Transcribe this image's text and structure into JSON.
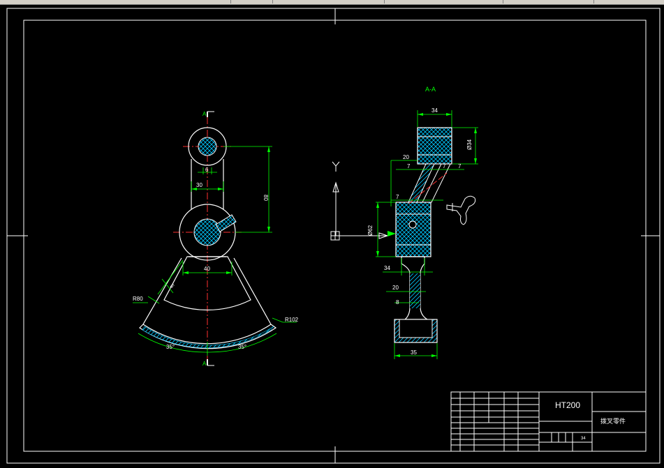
{
  "drawing": {
    "section_title": "A-A",
    "section_marks": [
      "A",
      "A"
    ],
    "material": "HT200",
    "part_name": "拨叉零件",
    "sheet_number": "34",
    "ucs_y_label": "Y",
    "colors": {
      "background": "#000000",
      "outline": "#ffffff",
      "dimension": "#00ff00",
      "centerline": "#ff0000",
      "hatch": "#00c8ff"
    }
  },
  "left_view": {
    "dims": {
      "d6": "6",
      "d30": "30",
      "d80": "80",
      "d40": "40",
      "d5": "5",
      "r80": "R80",
      "r102": "R102",
      "ang_left": "35°",
      "ang_right": "35°"
    }
  },
  "right_view": {
    "dims": {
      "d34_top": "34",
      "phi34": "Ø34",
      "d20_top": "20",
      "d7_a": "7",
      "d7_b": "7",
      "d7_c": "7",
      "d7_d": "7",
      "phi62": "Ø62",
      "d34_mid": "34",
      "d20_mid": "20",
      "d8": "8",
      "d35": "35"
    }
  }
}
